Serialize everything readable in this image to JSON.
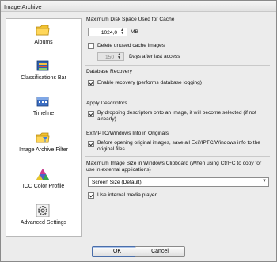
{
  "window": {
    "title": "Image Archive"
  },
  "sidebar": {
    "items": [
      {
        "label": "Albums",
        "icon": "folder-icon"
      },
      {
        "label": "Classifications Bar",
        "icon": "classifications-icon"
      },
      {
        "label": "Timeline",
        "icon": "timeline-icon"
      },
      {
        "label": "Image Archive Filter",
        "icon": "filter-folder-icon"
      },
      {
        "label": "ICC Color Profile",
        "icon": "color-triangle-icon"
      },
      {
        "label": "Advanced Settings",
        "icon": "gear-icon"
      }
    ]
  },
  "cache": {
    "title": "Maximum Disk Space Used for Cache",
    "size_value": "1024,0",
    "size_unit": "MB",
    "delete_label": "Delete unused cache images",
    "delete_checked": false,
    "days_value": "150",
    "days_label": "Days after last access"
  },
  "recovery": {
    "title": "Database Recovery",
    "enable_label": "Enable recovery (performs database logging)",
    "enable_checked": true
  },
  "descriptors": {
    "title": "Apply Descriptors",
    "option_line1": "By dropping descriptors onto an image, it will become selected (if not",
    "option_line2": "already)",
    "checked": true
  },
  "exif": {
    "title": "Exif/IPTC/Windows Info in Originals",
    "option_line1": "Before opening original images, save all Exif/IPTC/Windows info to the",
    "option_line2": "original files",
    "checked": true
  },
  "clipboard": {
    "title_line1": "Maximum Image Size in Windows Clipboard  (When using Ctrl+C to copy for",
    "title_line2": "use in external applications)",
    "selected": "Screen Size   (Default)"
  },
  "media": {
    "label": "Use internal media player",
    "checked": true
  },
  "buttons": {
    "ok": "OK",
    "cancel": "Cancel"
  },
  "colors": {
    "accent": "#4a6ea9",
    "panel": "#ececec"
  }
}
